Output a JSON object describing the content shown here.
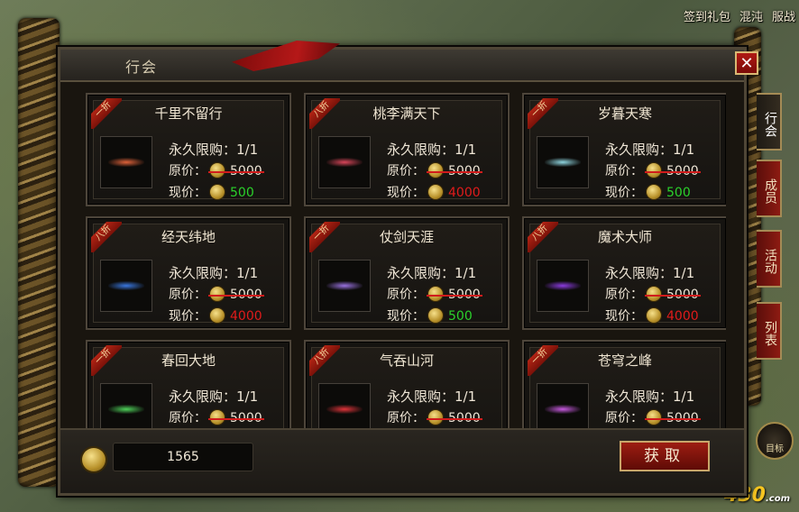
{
  "topbar": {
    "items": [
      "签到礼包",
      "混沌",
      "服战"
    ]
  },
  "logo": {
    "text": "430",
    "suffix": ".com"
  },
  "hud": {
    "label": "目标"
  },
  "panel": {
    "title": "行会",
    "close_label": "✕",
    "tabs": [
      "行会",
      "成员",
      "活动",
      "列表"
    ],
    "labels": {
      "limit": "永久限购：1/1",
      "original": "原价：",
      "current": "现价："
    },
    "cards": [
      {
        "name": "千里不留行",
        "badge": "一折",
        "original": "5000",
        "price": "500",
        "price_color": "#2bd12b",
        "thumb_color": "#e0633a"
      },
      {
        "name": "桃李满天下",
        "badge": "八折",
        "original": "5000",
        "price": "4000",
        "price_color": "#e01b1b",
        "thumb_color": "#d9465a"
      },
      {
        "name": "岁暮天寒",
        "badge": "一折",
        "original": "5000",
        "price": "500",
        "price_color": "#2bd12b",
        "thumb_color": "#8fd6e0"
      },
      {
        "name": "经天纬地",
        "badge": "八折",
        "original": "5000",
        "price": "4000",
        "price_color": "#e01b1b",
        "thumb_color": "#3a78e0"
      },
      {
        "name": "仗剑天涯",
        "badge": "一折",
        "original": "5000",
        "price": "500",
        "price_color": "#2bd12b",
        "thumb_color": "#9a72e0"
      },
      {
        "name": "魔术大师",
        "badge": "八折",
        "original": "5000",
        "price": "4000",
        "price_color": "#e01b1b",
        "thumb_color": "#8c3ce0"
      },
      {
        "name": "春回大地",
        "badge": "一折",
        "original": "5000",
        "price": "",
        "price_color": "#2bd12b",
        "thumb_color": "#4ed25a"
      },
      {
        "name": "气吞山河",
        "badge": "八折",
        "original": "5000",
        "price": "",
        "price_color": "#e01b1b",
        "thumb_color": "#e0343a"
      },
      {
        "name": "苍穹之峰",
        "badge": "一折",
        "original": "5000",
        "price": "",
        "price_color": "#2bd12b",
        "thumb_color": "#c85ae0"
      }
    ],
    "balance": "1565",
    "get_button": "获取"
  }
}
